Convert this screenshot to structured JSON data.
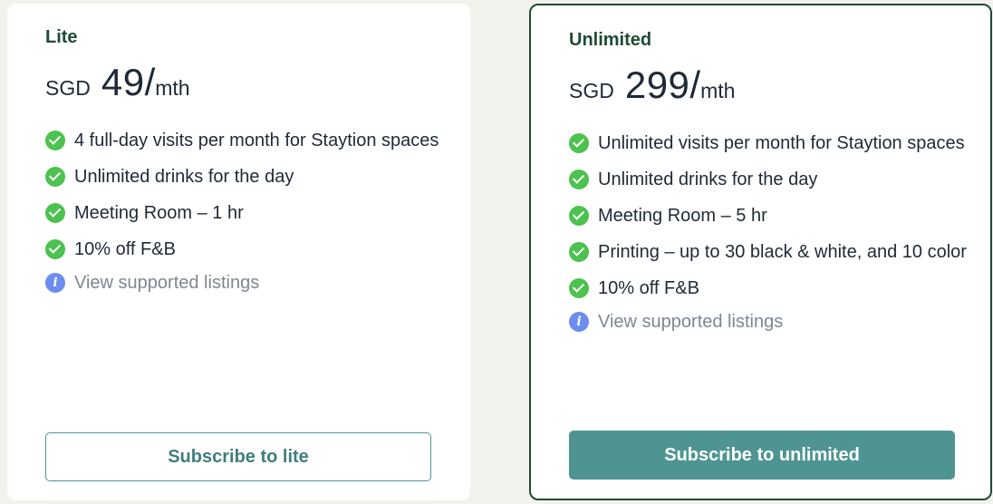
{
  "plans": [
    {
      "name": "Lite",
      "currency": "SGD",
      "amount": "49",
      "slash": "/",
      "period": "mth",
      "features": [
        "4 full-day visits per month for Staytion spaces",
        "Unlimited drinks for the day",
        "Meeting Room – 1 hr",
        "10% off F&B"
      ],
      "info_link": "View supported listings",
      "button_label": "Subscribe to lite"
    },
    {
      "name": "Unlimited",
      "currency": "SGD",
      "amount": "299",
      "slash": "/",
      "period": "mth",
      "features": [
        "Unlimited visits per month for Staytion spaces",
        "Unlimited drinks for the day",
        "Meeting Room – 5 hr",
        "Printing – up to 30 black & white, and 10 color",
        "10% off F&B"
      ],
      "info_link": "View supported listings",
      "button_label": "Subscribe to unlimited"
    }
  ],
  "icons": {
    "feature": "check-circle-icon",
    "info": "info-circle-icon",
    "info_glyph": "i"
  },
  "colors": {
    "accent": "#4e9591",
    "heading": "#1f4a34",
    "check": "#4cc24f",
    "info": "#6b8cf0"
  }
}
